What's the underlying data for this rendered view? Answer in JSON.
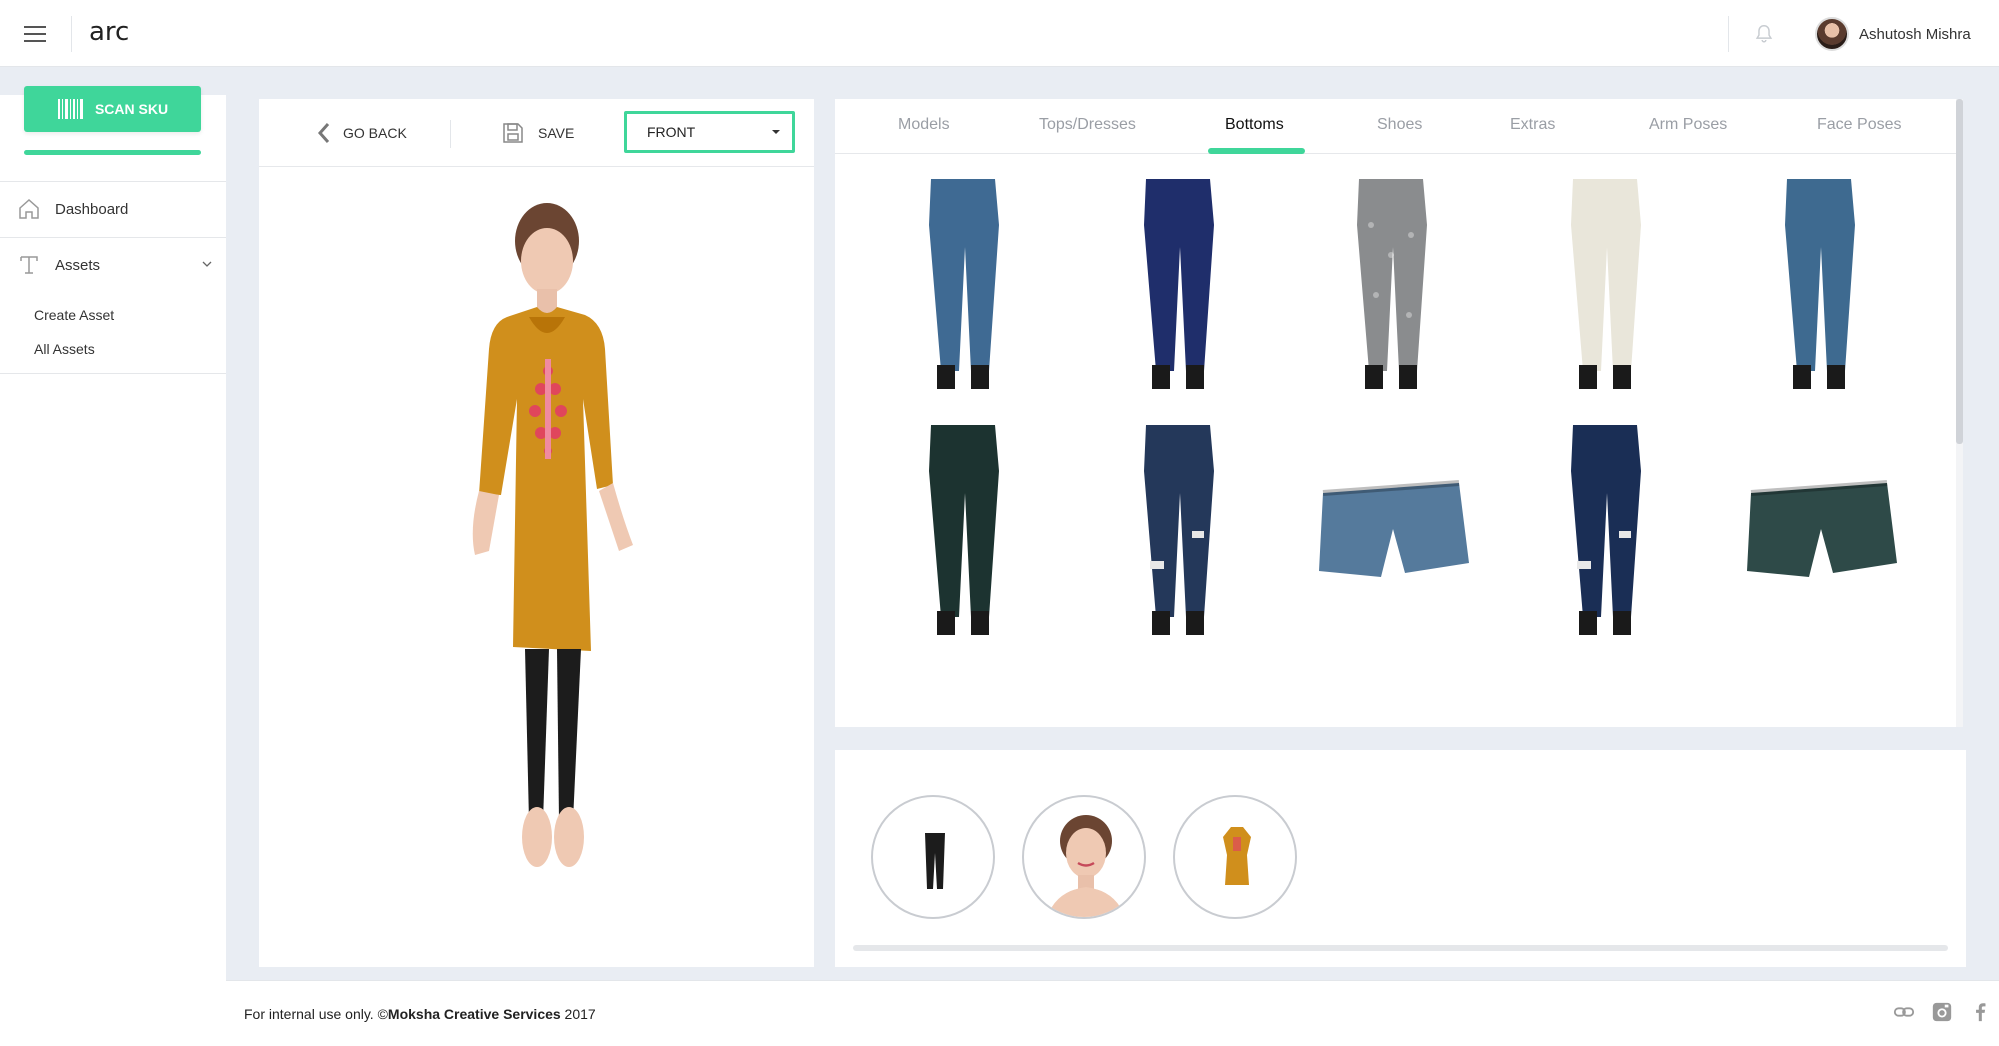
{
  "topbar": {
    "brand": "arc",
    "user_name": "Ashutosh Mishra",
    "menu_icon": "hamburger-icon",
    "bell_icon": "bell-icon"
  },
  "sidebar": {
    "scan_label": "SCAN SKU",
    "items": [
      {
        "label": "Dashboard",
        "icon": "home-icon"
      },
      {
        "label": "Assets",
        "icon": "text-asset-icon"
      }
    ],
    "sub_items": [
      "Create Asset",
      "All Assets"
    ]
  },
  "toolbar": {
    "go_back_label": "GO BACK",
    "save_label": "SAVE",
    "view_select": "FRONT"
  },
  "tabs": [
    {
      "label": "Models",
      "active": false
    },
    {
      "label": "Tops/Dresses",
      "active": false
    },
    {
      "label": "Bottoms",
      "active": true
    },
    {
      "label": "Shoes",
      "active": false
    },
    {
      "label": "Extras",
      "active": false
    },
    {
      "label": "Arm Poses",
      "active": false
    },
    {
      "label": "Face Poses",
      "active": false
    }
  ],
  "grid_items": [
    {
      "kind": "jeans",
      "color": "#3f6a93"
    },
    {
      "kind": "trousers",
      "color": "#1f2e6b"
    },
    {
      "kind": "patterned",
      "color": "#8a8c8e"
    },
    {
      "kind": "trousers",
      "color": "#e9e6da"
    },
    {
      "kind": "jeans",
      "color": "#3e6a90"
    },
    {
      "kind": "trousers",
      "color": "#1c3330"
    },
    {
      "kind": "ripped",
      "color": "#24385a"
    },
    {
      "kind": "shorts",
      "color": "#557a9c"
    },
    {
      "kind": "ripped",
      "color": "#1a2e55"
    },
    {
      "kind": "shorts",
      "color": "#2e4a48"
    },
    {
      "kind": "partial",
      "color": "#1f1f1f"
    },
    {
      "kind": "partial",
      "color": "#2f507a"
    },
    {
      "kind": "partial",
      "color": "#5f5558"
    },
    {
      "kind": "partial",
      "color": "#3c3d3f"
    }
  ],
  "selected_items": [
    "leggings",
    "face",
    "dress"
  ],
  "footer": {
    "prefix": "For internal use only. ©",
    "company": "Moksha Creative Services",
    "year": " 2017",
    "icons": [
      "link-icon",
      "instagram-icon",
      "facebook-icon"
    ]
  },
  "colors": {
    "accent": "#3fd69a",
    "background": "#e9edf3",
    "dress": "#d08f1c"
  }
}
